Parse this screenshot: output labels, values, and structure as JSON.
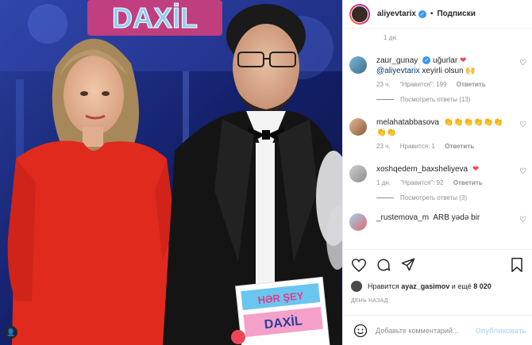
{
  "photo": {
    "backdrop_text": "DAXİL",
    "card_lines": [
      "HƏR ŞEY",
      "DAXİL"
    ]
  },
  "post_header": {
    "username": "aliyevtarix",
    "dot": "•",
    "follow_label": "Подписки"
  },
  "caption_time": "1 дн.",
  "comments": [
    {
      "username": "zaur_gunay",
      "verified": true,
      "text_before": "uğurlar",
      "emoji": "❤",
      "line2_mention": "@aliyevtarix",
      "line2_text": "xeyirli olsun",
      "line2_emoji": "🙌",
      "time": "23 ч.",
      "likes": "\"Нравится\": 199",
      "reply": "Ответить",
      "view_replies": "Посмотреть ответы (13)"
    },
    {
      "username": "melahatabbasova",
      "verified": false,
      "text": "👏👏👏👏👏👏👏👏",
      "time": "23 ч.",
      "likes": "Нравится: 1",
      "reply": "Ответить"
    },
    {
      "username": "xoshqedem_baxsheliyeva",
      "verified": false,
      "emoji": "❤",
      "time": "1 дн.",
      "likes": "\"Нравится\": 92",
      "reply": "Ответить",
      "view_replies": "Посмотреть ответы (3)"
    },
    {
      "username": "_rustemova_m",
      "text": "ARB yədə bir"
    }
  ],
  "likes_line": {
    "prefix": "Нравится",
    "user": "ayaz_gasimov",
    "middle": "и ещё",
    "count": "8 020"
  },
  "date_label": "ДЕНЬ НАЗАД",
  "comment_input": {
    "placeholder": "Добавьте комментарий...",
    "publish_label": "Опубликовать"
  },
  "icons": [
    "heart-icon",
    "comment-icon",
    "share-icon",
    "bookmark-icon",
    "smile-icon",
    "verified-icon"
  ],
  "colors": {
    "accent": "#3897f0",
    "link": "#00376b",
    "muted": "#8e8e8e",
    "publish_disabled": "#b2dffc"
  }
}
